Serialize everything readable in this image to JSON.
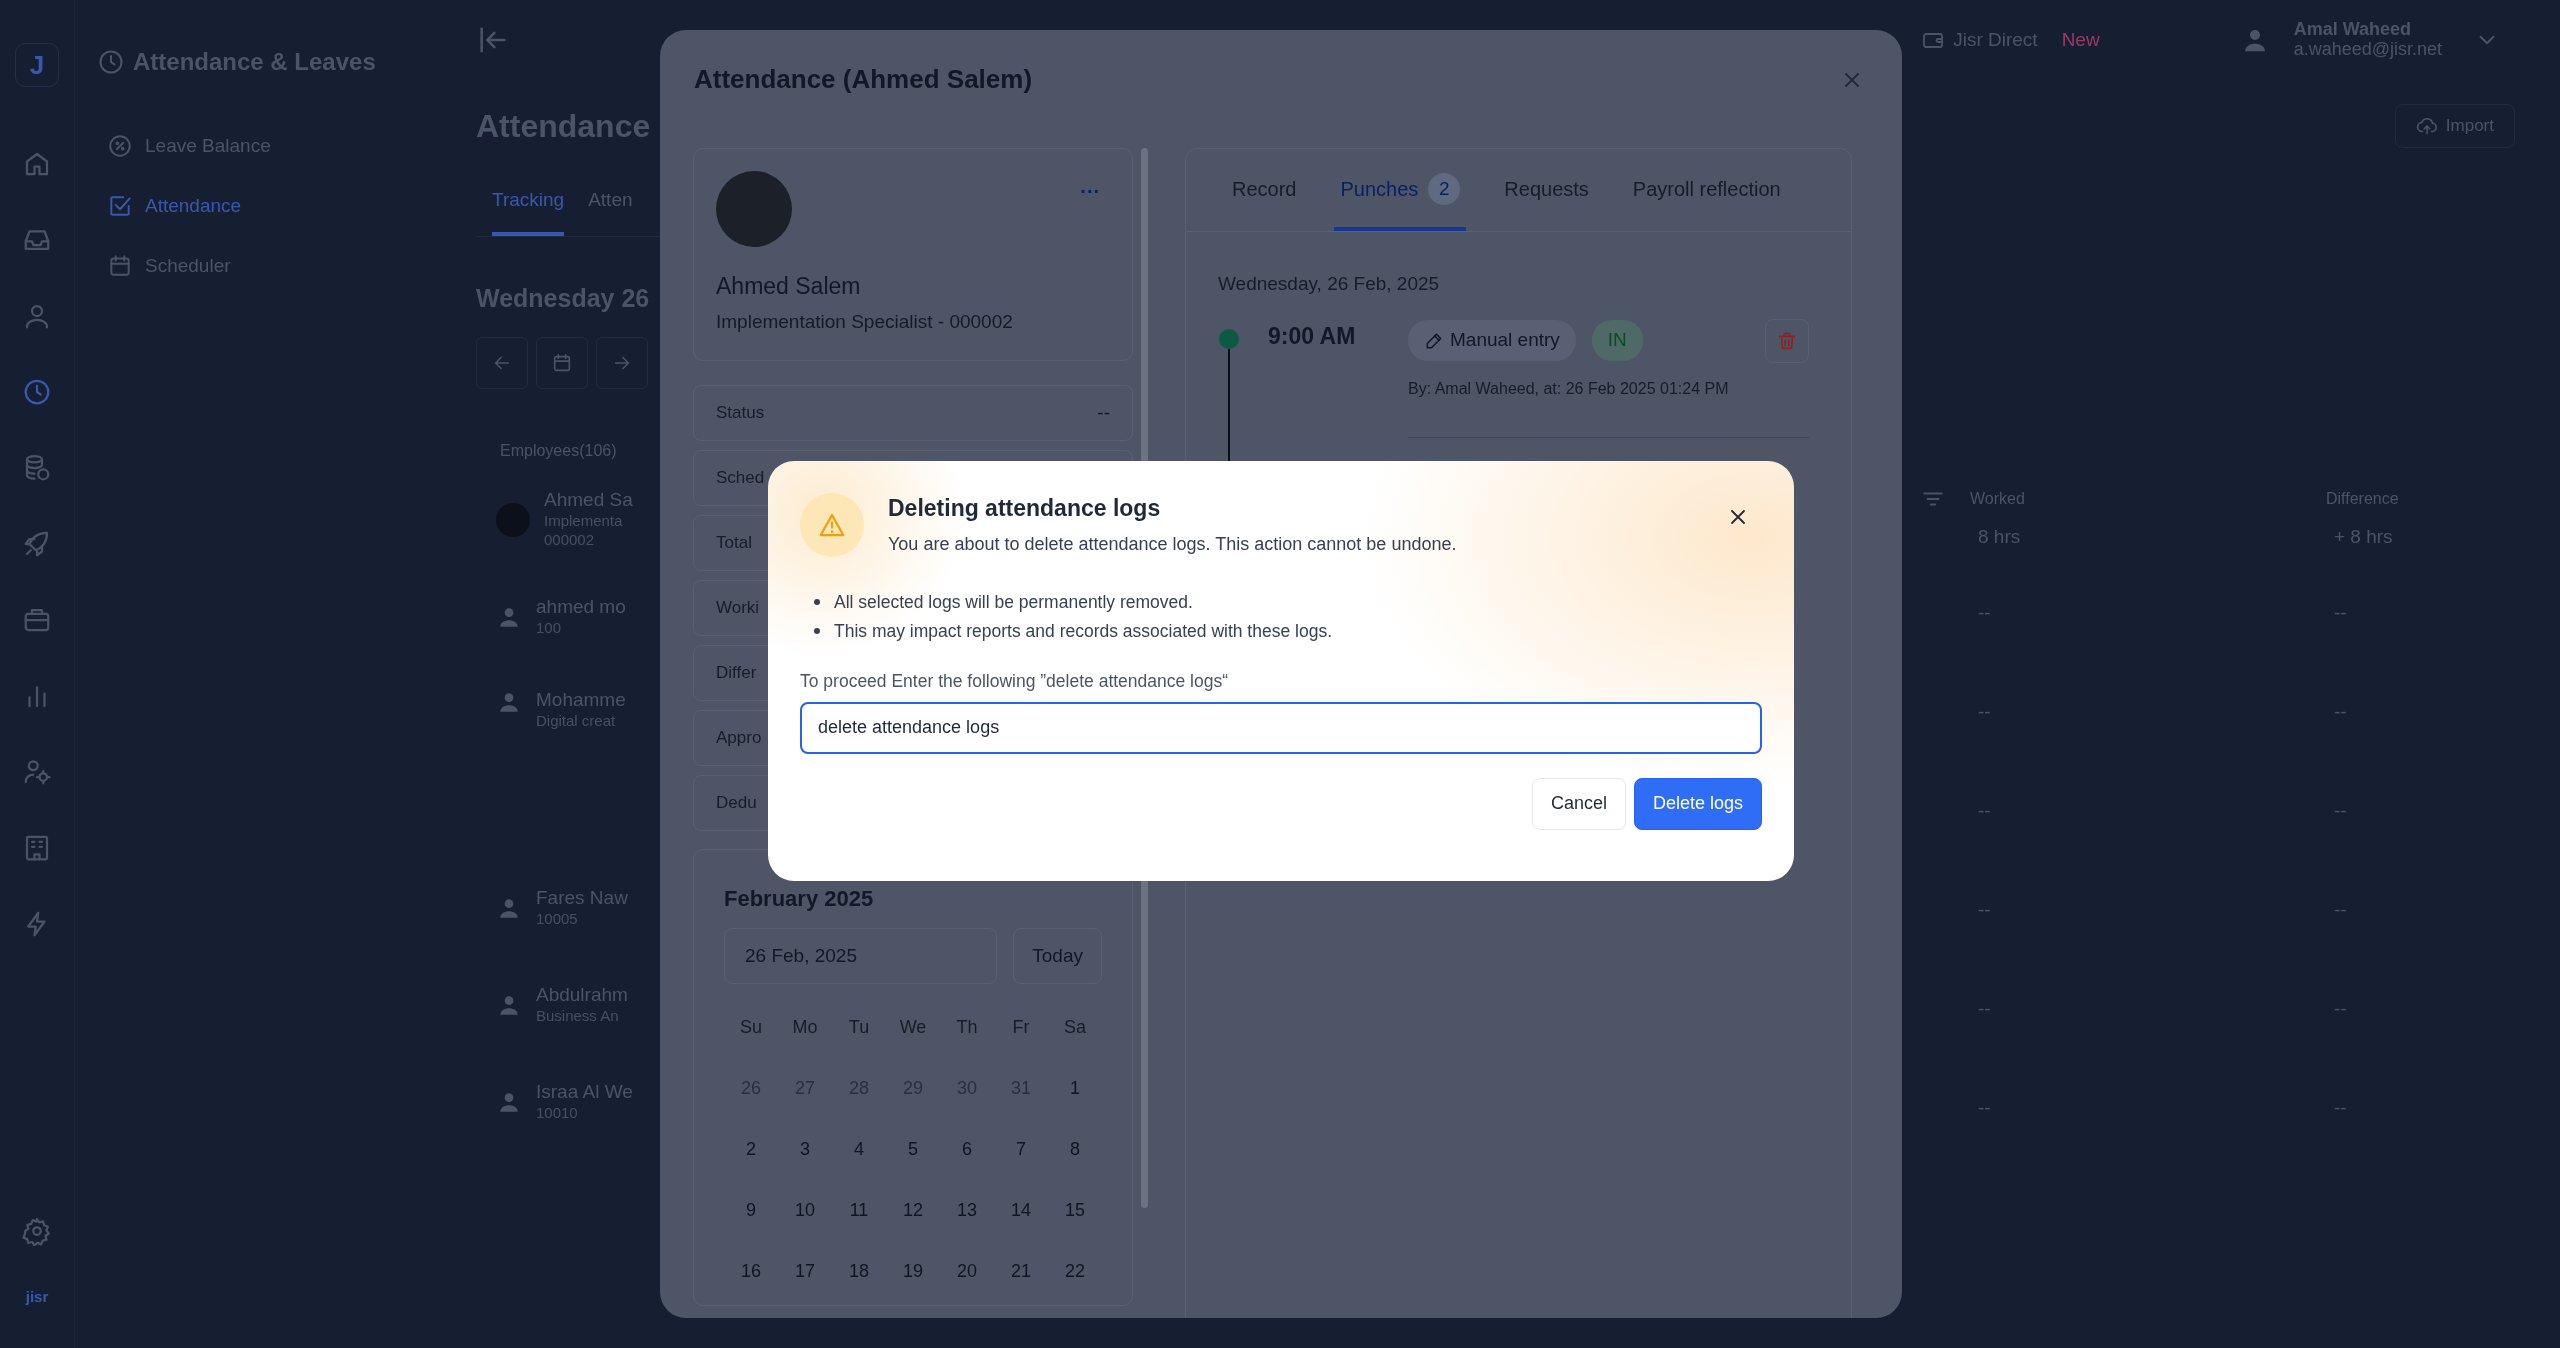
{
  "rail": {
    "logo": "J",
    "items": [
      {
        "selected": false
      },
      {
        "selected": false
      },
      {
        "selected": false
      },
      {
        "selected": true
      },
      {
        "selected": false
      },
      {
        "selected": false
      },
      {
        "selected": false
      },
      {
        "selected": false
      },
      {
        "selected": false
      },
      {
        "selected": false
      },
      {
        "selected": false
      }
    ],
    "brand": "jisr"
  },
  "module": {
    "title": "Attendance & Leaves",
    "items": [
      {
        "label": "Leave Balance",
        "selected": false
      },
      {
        "label": "Attendance",
        "selected": true
      },
      {
        "label": "Scheduler",
        "selected": false
      }
    ]
  },
  "topbar": {
    "direct_link": "Jisr Direct",
    "new_badge": "New",
    "user_name": "Amal Waheed",
    "user_email": "a.waheed@jisr.net"
  },
  "page": {
    "title": "Attendance",
    "import_button": "Import",
    "tabs": [
      {
        "label": "Tracking",
        "selected": true
      },
      {
        "label": "Atten",
        "selected": false
      }
    ],
    "date_heading": "Wednesday 26",
    "employees_label": "Employees(106)",
    "employees": [
      {
        "photo": true,
        "lines": [
          "Ahmed Sa",
          "Implementa",
          "000002"
        ]
      },
      {
        "photo": false,
        "lines": [
          "ahmed mo",
          "100"
        ]
      },
      {
        "photo": false,
        "lines": [
          "Mohamme",
          "Digital creat"
        ]
      },
      {
        "photo": false,
        "lines": [
          "Fares Naw",
          "10005"
        ]
      },
      {
        "photo": false,
        "lines": [
          "Abdulrahm",
          "Business An"
        ]
      },
      {
        "photo": false,
        "lines": [
          "Israa Al We",
          "10010"
        ]
      }
    ],
    "table": {
      "columns": [
        "Worked",
        "Difference"
      ],
      "rows": [
        [
          "8 hrs",
          "+ 8 hrs"
        ],
        [
          "--",
          "--"
        ],
        [
          "--",
          "--"
        ],
        [
          "--",
          "--"
        ],
        [
          "--",
          "--"
        ],
        [
          "--",
          "--"
        ],
        [
          "--",
          "--"
        ]
      ]
    }
  },
  "modal": {
    "title": "Attendance (Ahmed Salem)",
    "profile": {
      "name": "Ahmed Salem",
      "subtitle": "Implementation Specialist - 000002",
      "menu": "..."
    },
    "stats": [
      {
        "label": "Status",
        "value": "--"
      },
      {
        "label": "Sched"
      },
      {
        "label": "Total"
      },
      {
        "label": "Worki"
      },
      {
        "label": "Differ"
      },
      {
        "label": "Appro"
      },
      {
        "label": "Dedu"
      }
    ],
    "calendar": {
      "title": "February 2025",
      "date_value": "26 Feb, 2025",
      "today_button": "Today",
      "weekdays": [
        "Su",
        "Mo",
        "Tu",
        "We",
        "Th",
        "Fr",
        "Sa"
      ],
      "days": [
        {
          "label": "26",
          "outside": true
        },
        {
          "label": "27",
          "outside": true
        },
        {
          "label": "28",
          "outside": true
        },
        {
          "label": "29",
          "outside": true
        },
        {
          "label": "30",
          "outside": true
        },
        {
          "label": "31",
          "outside": true
        },
        {
          "label": "1",
          "outside": false
        },
        {
          "label": "2",
          "outside": false
        },
        {
          "label": "3",
          "outside": false
        },
        {
          "label": "4",
          "outside": false
        },
        {
          "label": "5",
          "outside": false
        },
        {
          "label": "6",
          "outside": false
        },
        {
          "label": "7",
          "outside": false
        },
        {
          "label": "8",
          "outside": false
        },
        {
          "label": "9",
          "outside": false
        },
        {
          "label": "10",
          "outside": false
        },
        {
          "label": "11",
          "outside": false
        },
        {
          "label": "12",
          "outside": false
        },
        {
          "label": "13",
          "outside": false
        },
        {
          "label": "14",
          "outside": false
        },
        {
          "label": "15",
          "outside": false
        },
        {
          "label": "16",
          "outside": false
        },
        {
          "label": "17",
          "outside": false
        },
        {
          "label": "18",
          "outside": false
        },
        {
          "label": "19",
          "outside": false
        },
        {
          "label": "20",
          "outside": false
        },
        {
          "label": "21",
          "outside": false
        },
        {
          "label": "22",
          "outside": false
        }
      ]
    },
    "tabs": [
      {
        "label": "Record",
        "selected": false
      },
      {
        "label": "Punches",
        "count": "2",
        "selected": true
      },
      {
        "label": "Requests",
        "selected": false
      },
      {
        "label": "Payroll reflection",
        "selected": false
      }
    ],
    "date": "Wednesday, 26 Feb, 2025",
    "punches": [
      {
        "time": "9:00 AM",
        "source": "Manual entry",
        "direction": "IN",
        "meta": "By: Amal Waheed, at: 26 Feb 2025 01:24 PM"
      }
    ]
  },
  "dialog": {
    "title": "Deleting attendance logs",
    "subtitle": "You are about to delete attendance logs. This action cannot be undone.",
    "bullets": [
      "All selected logs will be permanently removed.",
      "This may impact reports and records associated with these logs."
    ],
    "prompt": "To proceed Enter the following ”delete attendance logs“",
    "input": {
      "value": "delete attendance logs",
      "focused": true
    },
    "buttons": [
      {
        "label": "Cancel",
        "kind": "secondary"
      },
      {
        "label": "Delete logs",
        "kind": "primary"
      }
    ]
  }
}
